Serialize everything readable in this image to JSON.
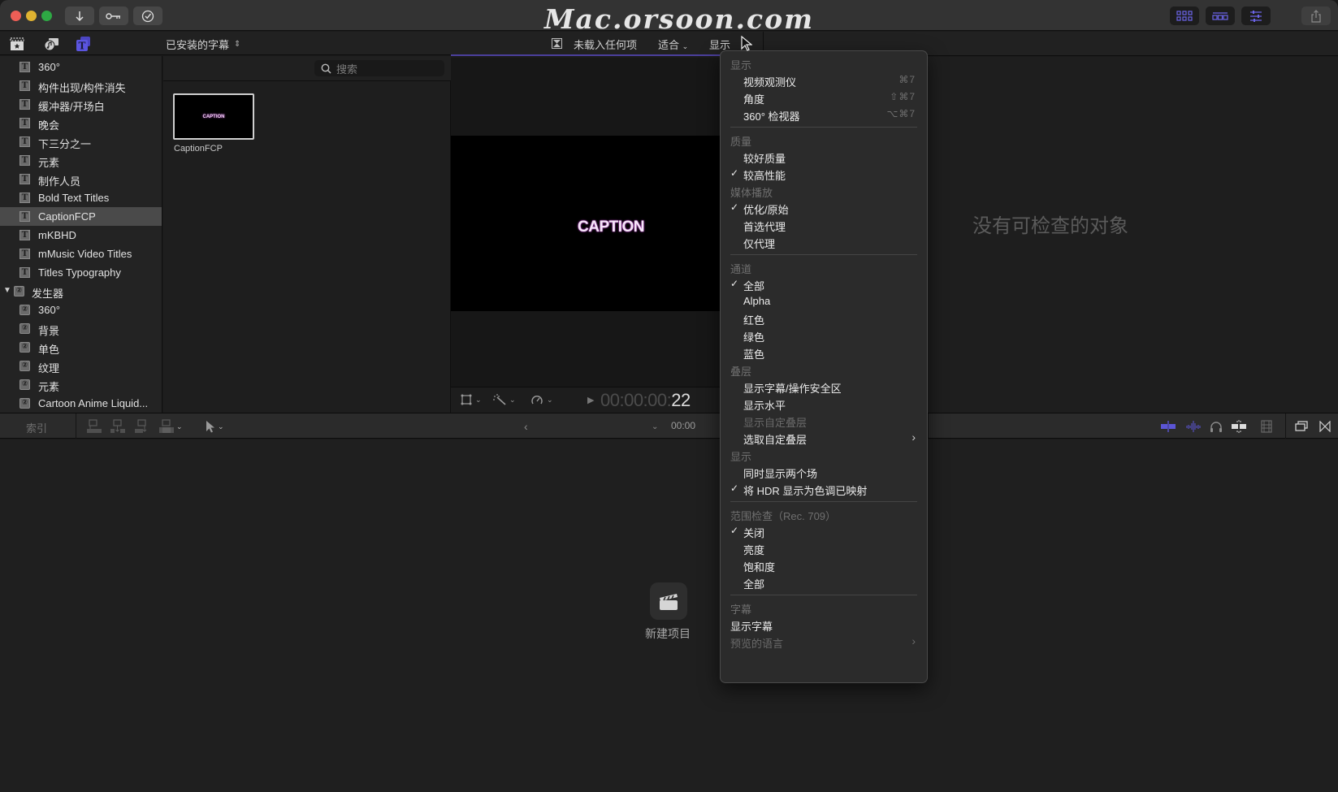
{
  "window": {
    "toolbar_left": [
      {
        "icon": "import-arrow-icon",
        "symbol": "↓"
      },
      {
        "icon": "key-icon",
        "symbol": "⚷"
      },
      {
        "icon": "checkmark-circle-icon",
        "symbol": "✓"
      }
    ],
    "watermark": "Mac.orsoon.com",
    "toolbar_right": [
      {
        "icon": "browser-grid-icon"
      },
      {
        "icon": "timeline-layout-icon"
      },
      {
        "icon": "inspector-sliders-icon"
      },
      {
        "icon": "share-icon"
      }
    ],
    "accent_color": "#5b55d6"
  },
  "browser": {
    "library_dropdown": "已安装的字幕",
    "search_placeholder": "搜索",
    "sidebar_items": [
      {
        "label": "360°",
        "type": "title"
      },
      {
        "label": "构件出现/构件消失",
        "type": "title"
      },
      {
        "label": "缓冲器/开场白",
        "type": "title"
      },
      {
        "label": "晚会",
        "type": "title"
      },
      {
        "label": "下三分之一",
        "type": "title"
      },
      {
        "label": "元素",
        "type": "title"
      },
      {
        "label": "制作人员",
        "type": "title"
      },
      {
        "label": "Bold Text Titles",
        "type": "title"
      },
      {
        "label": "CaptionFCP",
        "type": "title",
        "selected": true
      },
      {
        "label": "mKBHD",
        "type": "title"
      },
      {
        "label": "mMusic Video Titles",
        "type": "title"
      },
      {
        "label": "Titles Typography",
        "type": "title"
      },
      {
        "label": "发生器",
        "type": "group",
        "expanded": true
      },
      {
        "label": "360°",
        "type": "generator"
      },
      {
        "label": "背景",
        "type": "generator"
      },
      {
        "label": "单色",
        "type": "generator"
      },
      {
        "label": "纹理",
        "type": "generator"
      },
      {
        "label": "元素",
        "type": "generator"
      },
      {
        "label": "Cartoon Anime Liquid...",
        "type": "generator"
      }
    ],
    "clips": [
      {
        "thumbnail_text": "CAPTION",
        "label": "CaptionFCP"
      }
    ]
  },
  "viewer": {
    "status": "未载入任何项",
    "fit_label": "适合",
    "view_label": "显示",
    "preview_text": "CAPTION",
    "timecode_dim": "00:00:00:",
    "timecode_frame": "22"
  },
  "inspector": {
    "empty_message": "没有可检查的对象"
  },
  "timeline": {
    "index_label": "索引",
    "time": "00:00",
    "new_project_label": "新建项目"
  },
  "view_menu": {
    "items": [
      {
        "kind": "header",
        "label": "显示"
      },
      {
        "kind": "item",
        "label": "视频观测仪",
        "shortcut": "⌘7"
      },
      {
        "kind": "item",
        "label": "角度",
        "shortcut": "⇧⌘7"
      },
      {
        "kind": "item",
        "label": "360° 检视器",
        "shortcut": "⌥⌘7"
      },
      {
        "kind": "separator"
      },
      {
        "kind": "header",
        "label": "质量"
      },
      {
        "kind": "item",
        "label": "较好质量"
      },
      {
        "kind": "item",
        "label": "较高性能",
        "checked": true
      },
      {
        "kind": "header",
        "label": "媒体播放"
      },
      {
        "kind": "item",
        "label": "优化/原始",
        "checked": true
      },
      {
        "kind": "item",
        "label": "首选代理"
      },
      {
        "kind": "item",
        "label": "仅代理"
      },
      {
        "kind": "separator"
      },
      {
        "kind": "header",
        "label": "通道"
      },
      {
        "kind": "item",
        "label": "全部",
        "checked": true
      },
      {
        "kind": "item",
        "label": "Alpha"
      },
      {
        "kind": "item",
        "label": "红色"
      },
      {
        "kind": "item",
        "label": "绿色"
      },
      {
        "kind": "item",
        "label": "蓝色"
      },
      {
        "kind": "header",
        "label": "叠层"
      },
      {
        "kind": "item",
        "label": "显示字幕/操作安全区"
      },
      {
        "kind": "item",
        "label": "显示水平"
      },
      {
        "kind": "item",
        "label": "显示自定叠层",
        "disabled": true
      },
      {
        "kind": "item",
        "label": "选取自定叠层",
        "submenu": true
      },
      {
        "kind": "header",
        "label": "显示"
      },
      {
        "kind": "item",
        "label": "同时显示两个场"
      },
      {
        "kind": "item",
        "label": "将 HDR 显示为色调已映射",
        "checked": true
      },
      {
        "kind": "separator"
      },
      {
        "kind": "header",
        "label": "范围检查（Rec. 709）"
      },
      {
        "kind": "item",
        "label": "关闭",
        "checked": true
      },
      {
        "kind": "item",
        "label": "亮度"
      },
      {
        "kind": "item",
        "label": "饱和度"
      },
      {
        "kind": "item",
        "label": "全部"
      },
      {
        "kind": "separator"
      },
      {
        "kind": "header",
        "label": "字幕"
      },
      {
        "kind": "flat",
        "label": "显示字幕"
      },
      {
        "kind": "flat",
        "label": "预览的语言",
        "submenu": true,
        "disabled": true
      }
    ]
  }
}
